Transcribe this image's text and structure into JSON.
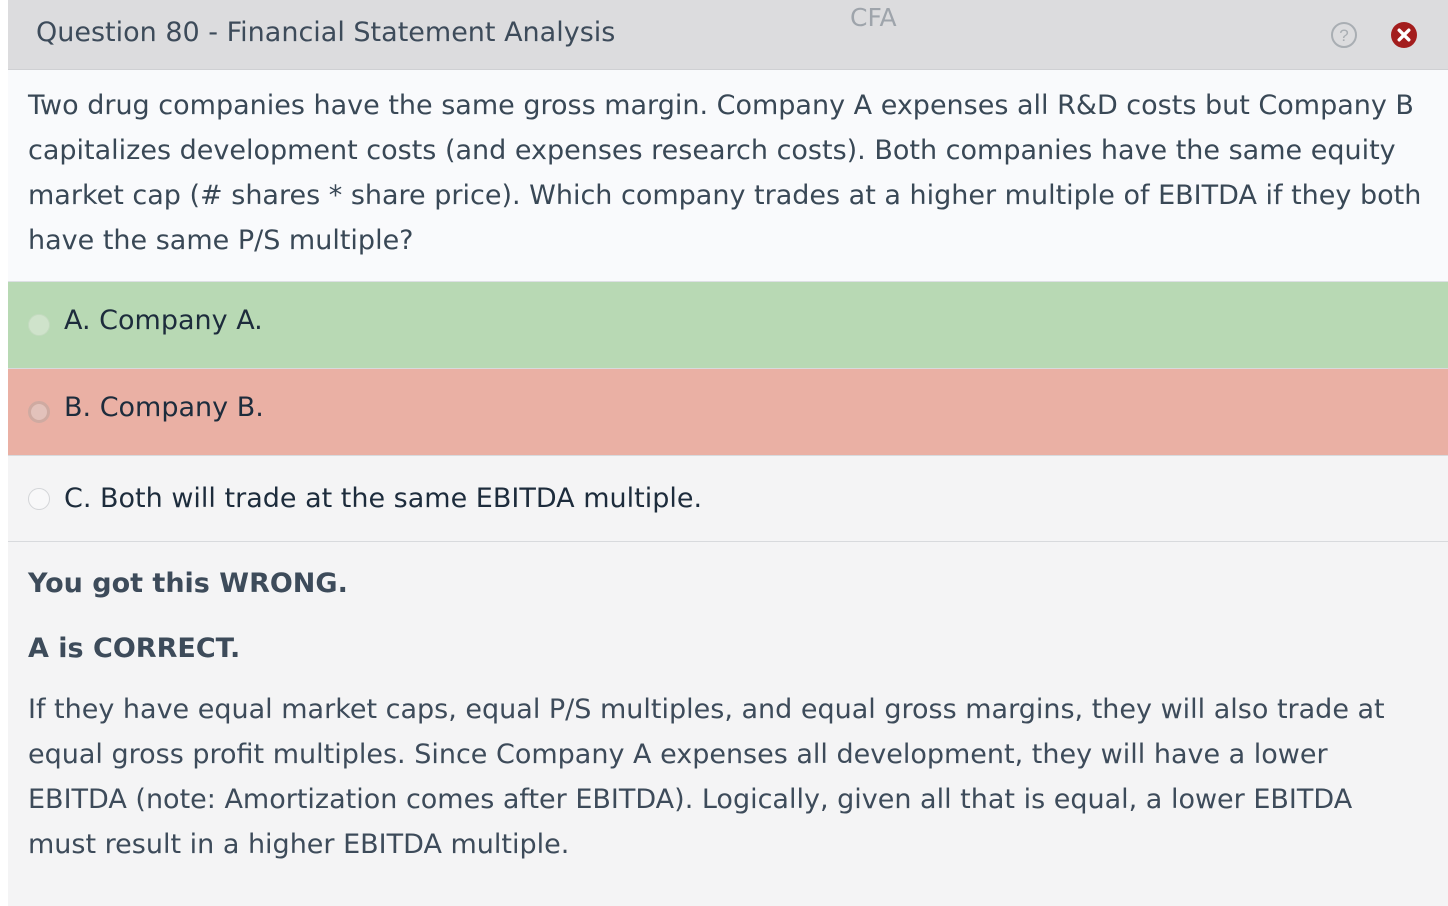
{
  "titlebar": {
    "title": "Question 80 - Financial Statement Analysis",
    "app_label": "CFA",
    "help_icon": "help-circle-icon",
    "close_icon": "close-circle-icon",
    "close_color": "#a31d1d"
  },
  "question": {
    "text": "Two drug companies have the same gross margin.  Company A expenses all R&D costs but Company B capitalizes development costs (and expenses research costs).  Both companies have the same equity market cap (# shares * share price).  Which company trades at a higher multiple of EBITDA if they both have the same P/S multiple?"
  },
  "options": [
    {
      "label": "A. Company A.",
      "state": "correct",
      "color": "#b8d9b4"
    },
    {
      "label": "B. Company B.",
      "state": "selected-wrong",
      "color": "#eab0a4"
    },
    {
      "label": "C. Both will trade at the same EBITDA multiple.",
      "state": "neutral",
      "color": "#f4f4f5"
    }
  ],
  "feedback": {
    "verdict": "You got this WRONG.",
    "correct_answer": "A is CORRECT.",
    "explanation": "If they have equal market caps, equal P/S multiples, and equal gross margins, they will also trade at equal gross profit multiples.  Since Company A expenses all development, they will have a lower EBITDA (note: Amortization comes after EBITDA).  Logically, given all that is equal, a lower EBITDA must result in a higher EBITDA multiple."
  }
}
